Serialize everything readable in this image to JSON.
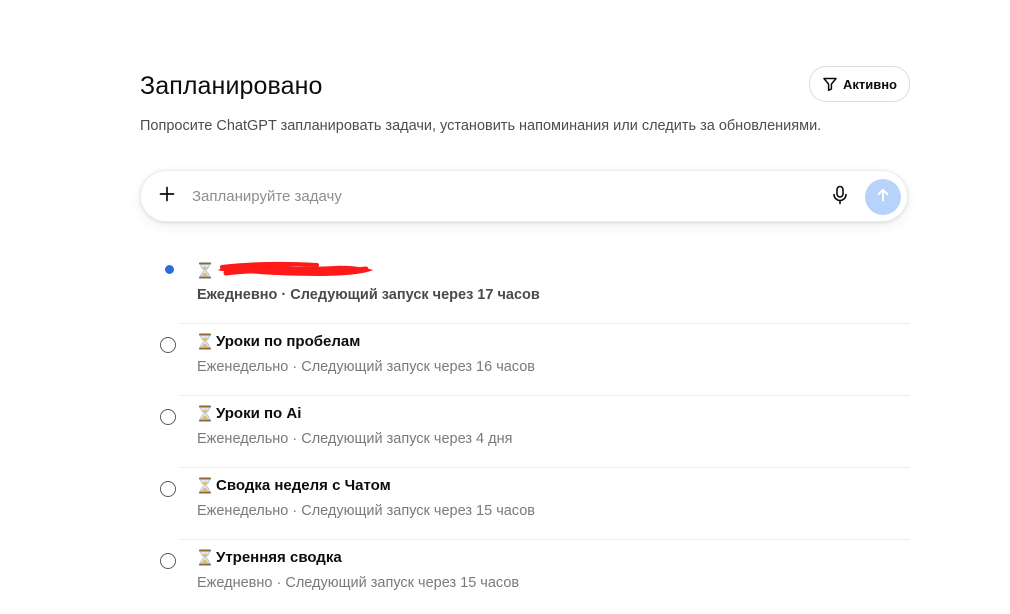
{
  "header": {
    "title": "Запланировано",
    "filter_label": "Активно",
    "subtitle": "Попросите ChatGPT запланировать задачи, установить напоминания или следить за обновлениями."
  },
  "composer": {
    "placeholder": "Запланируйте задачу",
    "value": ""
  },
  "tasks": [
    {
      "title": "",
      "schedule": "Ежедневно",
      "separator": "·",
      "next_run": "Следующий запуск через 17 часов",
      "active": true
    },
    {
      "title": "Уроки по пробелам",
      "schedule": "Еженедельно",
      "separator": "·",
      "next_run": "Следующий запуск через 16 часов",
      "active": false
    },
    {
      "title": "Уроки по Ai",
      "schedule": "Еженедельно",
      "separator": "·",
      "next_run": "Следующий запуск через 4 дня",
      "active": false
    },
    {
      "title": "Сводка неделя с Чатом",
      "schedule": "Еженедельно",
      "separator": "·",
      "next_run": "Следующий запуск через 15 часов",
      "active": false
    },
    {
      "title": "Утренняя сводка",
      "schedule": "Ежедневно",
      "separator": "·",
      "next_run": "Следующий запуск через 15 часов",
      "active": false
    }
  ],
  "colors": {
    "active_dot": "#2f6bd8",
    "send_button": "#b7d3fb",
    "redaction": "#ff1a1a"
  },
  "icons": {
    "filter": "filter-icon",
    "plus": "plus-icon",
    "mic": "microphone-icon",
    "send": "arrow-up-icon",
    "task": "hourglass-icon"
  }
}
